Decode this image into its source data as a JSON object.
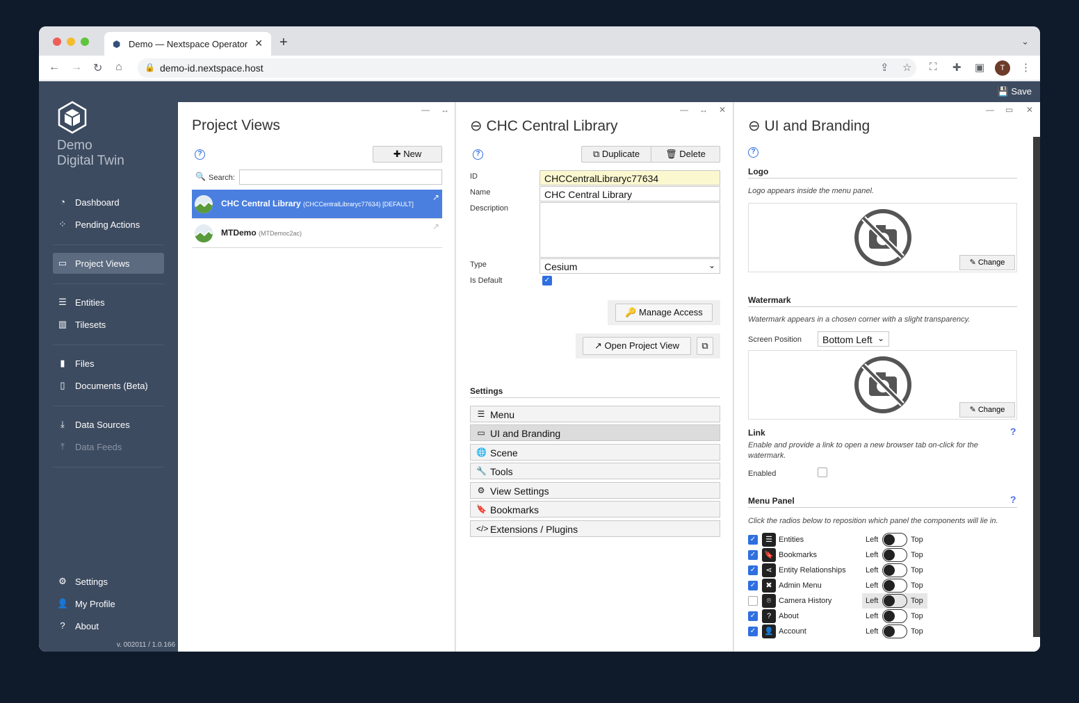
{
  "browser": {
    "tab_title": "Demo — Nextspace Operator",
    "url": "demo-id.nextspace.host",
    "avatar_letter": "T"
  },
  "app": {
    "brand_line1": "Demo",
    "brand_line2": "Digital Twin",
    "save_label": "Save",
    "version": "v. 002011 / 1.0.166",
    "nav": {
      "dashboard": "Dashboard",
      "pending": "Pending Actions",
      "project_views": "Project Views",
      "entities": "Entities",
      "tilesets": "Tilesets",
      "files": "Files",
      "documents": "Documents (Beta)",
      "data_sources": "Data Sources",
      "data_feeds": "Data Feeds",
      "settings": "Settings",
      "my_profile": "My Profile",
      "about": "About"
    }
  },
  "project_views": {
    "title": "Project Views",
    "new_label": "New",
    "search_label": "Search:",
    "search_value": "",
    "items": [
      {
        "name": "CHC Central Library",
        "sub": "(CHCCentralLibraryc77634) [DEFAULT]"
      },
      {
        "name": "MTDemo",
        "sub": "(MTDemoc2ac)"
      }
    ]
  },
  "detail": {
    "title": "CHC Central Library",
    "duplicate_label": "Duplicate",
    "delete_label": "Delete",
    "id_label": "ID",
    "id_value": "CHCCentralLibraryc77634",
    "name_label": "Name",
    "name_value": "CHC Central Library",
    "description_label": "Description",
    "description_value": "",
    "type_label": "Type",
    "type_value": "Cesium",
    "is_default_label": "Is Default",
    "is_default": true,
    "manage_access_label": "Manage Access",
    "open_view_label": "Open Project View",
    "settings_heading": "Settings",
    "settings_items": [
      "Menu",
      "UI and Branding",
      "Scene",
      "Tools",
      "View Settings",
      "Bookmarks",
      "Extensions / Plugins"
    ]
  },
  "branding": {
    "title": "UI and Branding",
    "logo_heading": "Logo",
    "logo_desc": "Logo appears inside the menu panel.",
    "change_label": "Change",
    "watermark_heading": "Watermark",
    "watermark_desc": "Watermark appears in a chosen corner with a slight transparency.",
    "screen_position_label": "Screen Position",
    "screen_position_value": "Bottom Left",
    "link_heading": "Link",
    "link_desc": "Enable and provide a link to open a new browser tab on-click for the watermark.",
    "enabled_label": "Enabled",
    "link_enabled": false,
    "menu_panel_heading": "Menu Panel",
    "menu_panel_desc": "Click the radios below to reposition which panel the components will lie in.",
    "left_label": "Left",
    "top_label": "Top",
    "menu_items": [
      {
        "name": "Entities",
        "checked": true
      },
      {
        "name": "Bookmarks",
        "checked": true
      },
      {
        "name": "Entity Relationships",
        "checked": true
      },
      {
        "name": "Admin Menu",
        "checked": true
      },
      {
        "name": "Camera History",
        "checked": false
      },
      {
        "name": "About",
        "checked": true
      },
      {
        "name": "Account",
        "checked": true
      }
    ]
  },
  "colors": {
    "sidebar": "#3d4b60",
    "accent": "#4a7fe0",
    "page_bg": "#0f1b2b"
  }
}
